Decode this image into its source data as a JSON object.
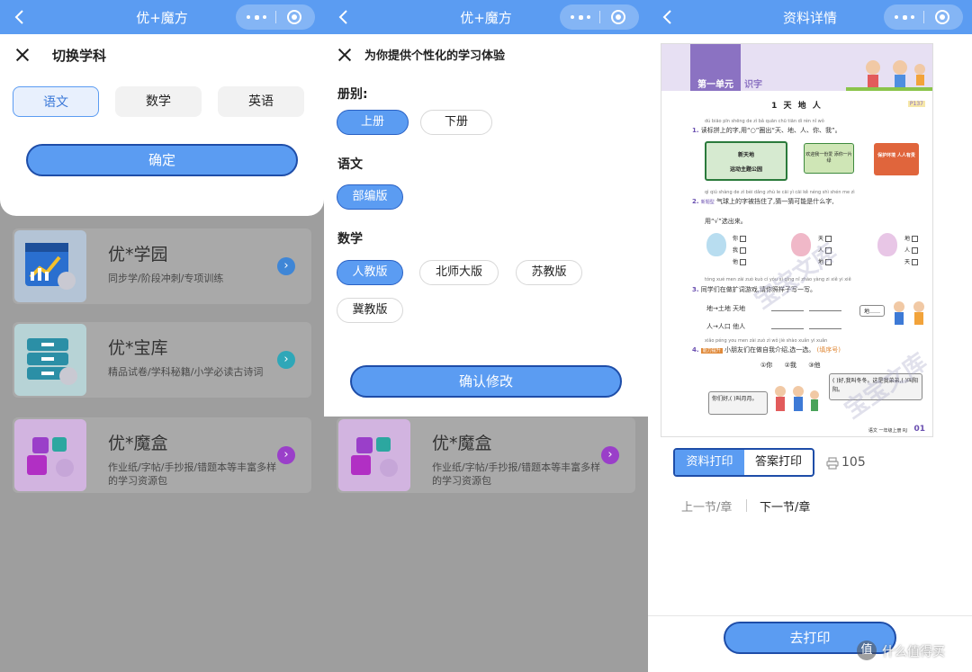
{
  "panel1": {
    "title": "优+魔方",
    "sheet_title": "切换学科",
    "subjects": [
      "语文",
      "数学",
      "英语"
    ],
    "selected_subject": "语文",
    "confirm_label": "确定",
    "cards": [
      {
        "title": "优*学园",
        "desc": "同步学/阶段冲刺/专项训练",
        "accent": "#3f86d6"
      },
      {
        "title": "优*宝库",
        "desc": "精品试卷/学科秘籍/小学必读古诗词",
        "accent": "#2fa7b8"
      },
      {
        "title": "优*魔盒",
        "desc": "作业纸/字帖/手抄报/错题本等丰富多样的学习资源包",
        "accent": "#9a3fc9"
      }
    ]
  },
  "panel2": {
    "title": "优+魔方",
    "sheet_title": "为你提供个性化的学习体验",
    "volume_label": "册别:",
    "volume_options": [
      "上册",
      "下册"
    ],
    "volume_selected": "上册",
    "chinese_label": "语文",
    "chinese_options": [
      "部编版"
    ],
    "chinese_selected": "部编版",
    "math_label": "数学",
    "math_options": [
      "人教版",
      "北师大版",
      "苏教版",
      "冀教版"
    ],
    "math_selected": "人教版",
    "confirm_label": "确认修改",
    "card": {
      "title": "优*魔盒",
      "desc": "作业纸/字帖/手抄报/错题本等丰富多样的学习资源包"
    }
  },
  "panel3": {
    "title": "资料详情",
    "document": {
      "unit": "第一单元",
      "unit_sub": "识字",
      "lesson": "1 天 地 人",
      "page_ref": "P137",
      "pinyin1": "dú biāo pīn shēng de zì bǎ quān chū tiān dì rén nǐ wǒ",
      "q1": "读标拼上的字,用“○”圈出“天、地、人、你、我”。",
      "sign1a": "新天地",
      "sign1b": "运动主题公园",
      "sign2": "欢迎我一份爱 添你一片绿",
      "sign3": "保护环境 人人有责",
      "pinyin2": "qì qiú shàng de zì bèi dǎng zhù le cāi yì cāi kě néng shì shén me zì",
      "q2_tag": "新题型",
      "q2": "气球上的字被挡住了,猜一猜可能是什么字,",
      "q2b": "用“√”选出来。",
      "balloon_opts": [
        "你",
        "我",
        "他",
        "天",
        "人",
        "地",
        "地",
        "人",
        "天"
      ],
      "pinyin3": "tóng xué men zài zuò kuò cí yóu xì qǐng nǐ zhào yàng zi xiě yi xiě",
      "q3": "同学们在做扩词游戏,请你照样子写一写。",
      "q3_row1": "地→土地  天地",
      "q3_row2": "人→人口  他人",
      "q3_bubble": "地……",
      "pinyin4": "xiǎo péng you men zài zuò zì wǒ jiè shào xuǎn yi xuǎn",
      "q4_tag": "能力提升",
      "q4": "小朋友们在做自我介绍,选一选。",
      "q4_hint": "(填序号)",
      "q4_opts": [
        "①你",
        "②我",
        "③他"
      ],
      "q4_s1": "(   )好,我叫冬冬。这是我弟弟,(   )叫阳阳。",
      "q4_s2": "你们好,(   )叫月月。",
      "footer": "语文  一年级上册  RJ",
      "page_no": "01",
      "watermark": "宝宝文库"
    },
    "print_tab_active": "资料打印",
    "print_tab_other": "答案打印",
    "print_count": "105",
    "prev_label": "上一节/章",
    "next_label": "下一节/章",
    "go_print_label": "去打印",
    "brand_badge": "值",
    "brand_text": "什么值得买"
  }
}
